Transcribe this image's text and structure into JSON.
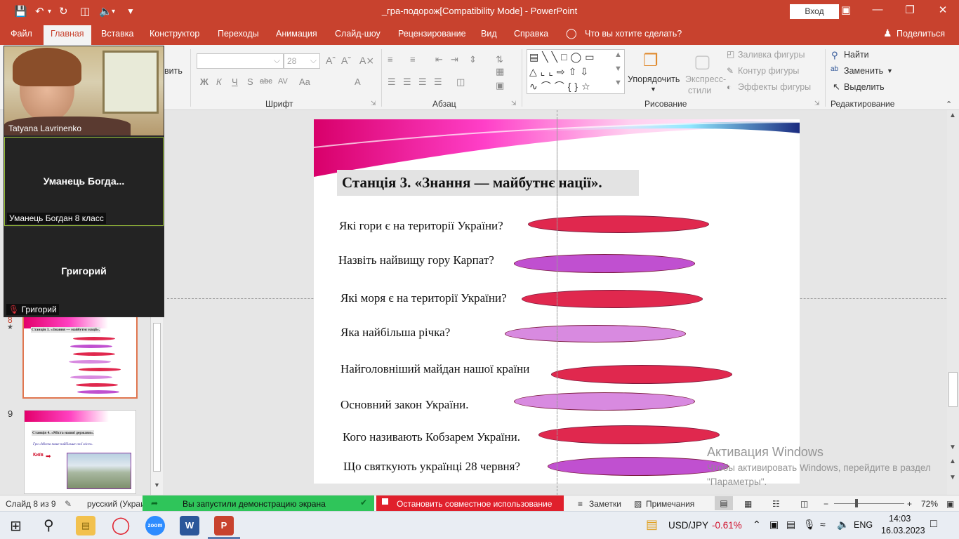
{
  "window": {
    "title": "_гра-подорож[Compatibility Mode]  -  PowerPoint",
    "signin": "Вход"
  },
  "tabs": [
    "Файл",
    "Главная",
    "Вставка",
    "Конструктор",
    "Переходы",
    "Анимация",
    "Слайд-шоу",
    "Рецензирование",
    "Вид",
    "Справка"
  ],
  "tell_me": "Что вы хотите сделать?",
  "share": "Поделиться",
  "ribbon": {
    "clipboard_partial": "вить",
    "font_size": "28",
    "font_group": "Шрифт",
    "paragraph_group": "Абзац",
    "drawing_group": "Рисование",
    "editing_group": "Редактирование",
    "arrange": "Упорядочить",
    "express_line1": "Экспресс-",
    "express_line2": "стили",
    "shape_fill": "Заливка фигуры",
    "shape_outline": "Контур фигуры",
    "shape_effects": "Эффекты фигуры",
    "find": "Найти",
    "replace": "Заменить",
    "select": "Выделить",
    "font_buttons": [
      "Ж",
      "К",
      "Ч",
      "S",
      "abc",
      "AV",
      "Aa",
      "A"
    ]
  },
  "zoom": {
    "participant1_label": "Tatyana Lavrinenko",
    "participant2_name": "Уманець  Богда...",
    "participant2_label": "Уманець Богдан 8 класс",
    "participant3_name": "Григорий",
    "participant3_label": "Григорий"
  },
  "thumbnails": {
    "slide8_title": "Станція 3. «Знання — майбутнє нації».",
    "slide9_number": "9",
    "slide9_title": "Станція 4. «Міста нашої держави».",
    "slide9_subtitle": "Гра «Міста наше найбільше свої міст».",
    "slide9_city": "Київ"
  },
  "slide": {
    "title": "Станція 3. «Знання  — майбутнє нації».",
    "questions": [
      {
        "text": "Які гори є на території України?",
        "color": "#e0284e"
      },
      {
        "text": "Назвіть найвищу гору Карпат?",
        "color": "#c050d0"
      },
      {
        "text": "Які моря є на території України?",
        "color": "#e0284e"
      },
      {
        "text": "Яка найбільша річка?",
        "color": "#d88ae0"
      },
      {
        "text": "Найголовніший майдан нашої країни",
        "color": "#e0284e"
      },
      {
        "text": "Основний закон України.",
        "color": "#d88ae0"
      },
      {
        "text": "Кого називають Кобзарем України.",
        "color": "#e0284e"
      },
      {
        "text": "Що святкують українці 28 червня?",
        "color": "#c050d0"
      }
    ]
  },
  "watermark": {
    "title": "Активация Windows",
    "subtitle": "Чтобы активировать Windows, перейдите в раздел \"Параметры\"."
  },
  "status": {
    "slide_info": "Слайд 8 из 9",
    "language": "русский (Украи",
    "sharing": "Вы запустили демонстрацию экрана",
    "stop_sharing": "Остановить совместное использование",
    "notes": "Заметки",
    "comments": "Примечания",
    "zoom_level": "72%"
  },
  "taskbar": {
    "ticker": "USD/JPY",
    "change": "-0.61%",
    "lang": "ENG",
    "time": "14:03",
    "date": "16.03.2023"
  },
  "colors": {
    "accent": "#c8422e",
    "share_green": "#2fc55a",
    "share_red": "#e0202c"
  }
}
